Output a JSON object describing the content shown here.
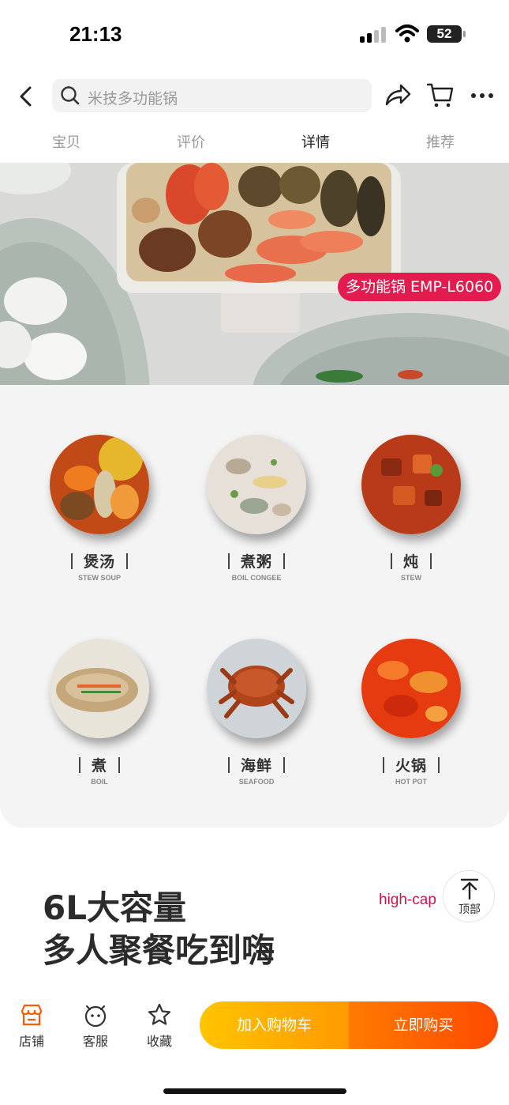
{
  "status_bar": {
    "time": "21:13",
    "battery": "52"
  },
  "header": {
    "search_placeholder": "米技多功能锅",
    "icons": [
      "back-icon",
      "search-icon",
      "share-icon",
      "cart-icon",
      "more-icon"
    ]
  },
  "tabs": [
    {
      "label": "宝贝",
      "active": false
    },
    {
      "label": "评价",
      "active": false
    },
    {
      "label": "详情",
      "active": true
    },
    {
      "label": "推荐",
      "active": false
    }
  ],
  "hero": {
    "badge": "多功能锅 EMP-L6060"
  },
  "features": [
    {
      "label": "煲汤",
      "sub": "STEW SOUP"
    },
    {
      "label": "煮粥",
      "sub": "BOIL CONGEE"
    },
    {
      "label": "炖",
      "sub": "STEW"
    },
    {
      "label": "煮",
      "sub": "BOIL"
    },
    {
      "label": "海鲜",
      "sub": "SEAFOOD"
    },
    {
      "label": "火锅",
      "sub": "HOT POT"
    }
  ],
  "capacity": {
    "line1": "6L大容量",
    "line2": "多人聚餐吃到嗨",
    "en": "high-cap"
  },
  "back_to_top": {
    "label": "顶部"
  },
  "bottom_bar": {
    "shop": "店铺",
    "service": "客服",
    "favorite": "收藏",
    "add_to_cart": "加入购物车",
    "buy_now": "立即购买"
  },
  "colors": {
    "accent": "#e31b4f",
    "cart_button": "#ffb400",
    "buy_button": "#ff5a00"
  }
}
